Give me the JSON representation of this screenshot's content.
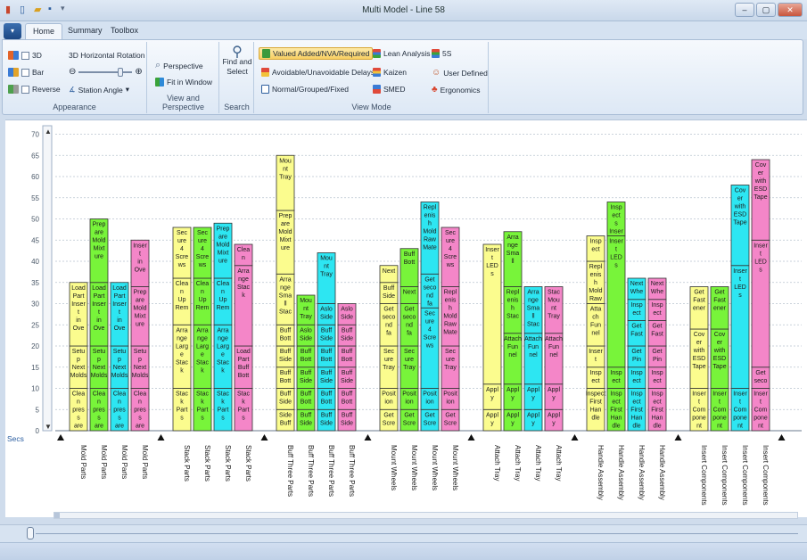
{
  "window": {
    "title": "Multi Model - Line 58",
    "controls": [
      "–",
      "▢",
      "✕"
    ]
  },
  "tabs": [
    {
      "label": "Home",
      "active": true
    },
    {
      "label": "Summary",
      "active": false
    },
    {
      "label": "Toolbox",
      "active": false
    }
  ],
  "ribbon": {
    "appearance": {
      "label": "Appearance",
      "check_3d": "3D",
      "check_bar": "Bar",
      "check_reverse": "Reverse",
      "rotation_label": "3D Horizontal Rotation",
      "station_angle": "Station Angle"
    },
    "view": {
      "label": "View and Perspective",
      "perspective": "Perspective",
      "fit_window": "Fit in Window"
    },
    "search": {
      "label": "Search",
      "find_select_1": "Find and",
      "find_select_2": "Select"
    },
    "view_mode": {
      "label": "View Mode",
      "valued_added": "Valued Added/NVA/Required",
      "avoidable": "Avoidable/Unavoidable Delays",
      "normal": "Normal/Grouped/Fixed",
      "lean": "Lean Analysis",
      "kaizen": "Kaizen",
      "smed": "SMED",
      "five_s": "5S",
      "user_defined": "User Defined",
      "ergonomics": "Ergonomics"
    }
  },
  "colors": {
    "yellow": "#fbfc8e",
    "green": "#78f43a",
    "cyan": "#2de6f2",
    "pink": "#f486c8"
  },
  "chart_data": {
    "type": "bar",
    "ylabel": "Secs",
    "ylim": [
      0,
      72
    ],
    "yticks": [
      0,
      5,
      10,
      15,
      20,
      25,
      30,
      35,
      40,
      45,
      50,
      55,
      60,
      65,
      70
    ],
    "grid": true,
    "stacked": true,
    "groups": [
      {
        "name": "Mold Parts",
        "bars": [
          {
            "color": "yellow",
            "segments": [
              {
                "value": 10,
                "label": "Clea n pres s are a"
              },
              {
                "value": 10,
                "label": "Setu p Next Molds"
              },
              {
                "value": 15,
                "label": "Load Part Inser t in Ove"
              }
            ]
          },
          {
            "color": "green",
            "segments": [
              {
                "value": 10,
                "label": "Clea n pres s are a"
              },
              {
                "value": 10,
                "label": "Setu p Next Molds"
              },
              {
                "value": 15,
                "label": "Load Part Inser t in Ove"
              },
              {
                "value": 15,
                "label": "Prep are Mold Mixt ure"
              }
            ]
          },
          {
            "color": "cyan",
            "segments": [
              {
                "value": 10,
                "label": "Clea n pres s are a"
              },
              {
                "value": 10,
                "label": "Setu p Next Molds"
              },
              {
                "value": 15,
                "label": "Load Part Inser t in Ove"
              }
            ]
          },
          {
            "color": "pink",
            "segments": [
              {
                "value": 10,
                "label": "Clea n pres s are a"
              },
              {
                "value": 10,
                "label": "Setu p Next Molds"
              },
              {
                "value": 14,
                "label": "Prep are Mold Mixt ure"
              },
              {
                "value": 11,
                "label": "Inser t in Ove"
              }
            ]
          }
        ]
      },
      {
        "name": "Stack Parts",
        "bars": [
          {
            "color": "yellow",
            "segments": [
              {
                "value": 10,
                "label": "Stac k Part s"
              },
              {
                "value": 15,
                "label": "Arra nge Larg e Stac k"
              },
              {
                "value": 11,
                "label": "Clea n Up Rem"
              },
              {
                "value": 12,
                "label": "Sec ure 4 Scre ws"
              }
            ]
          },
          {
            "color": "green",
            "segments": [
              {
                "value": 10,
                "label": "Stac k Part s"
              },
              {
                "value": 15,
                "label": "Arra nge Larg e Stac k"
              },
              {
                "value": 11,
                "label": "Clea n Up Rem"
              },
              {
                "value": 12,
                "label": "Sec ure 4 Scre ws"
              }
            ]
          },
          {
            "color": "cyan",
            "segments": [
              {
                "value": 10,
                "label": "Stac k Part s"
              },
              {
                "value": 15,
                "label": "Arra nge Larg e Stac k"
              },
              {
                "value": 11,
                "label": "Clea n Up Rem"
              },
              {
                "value": 13,
                "label": "Prep are Mold Mixt ure"
              }
            ]
          },
          {
            "color": "pink",
            "segments": [
              {
                "value": 10,
                "label": "Stac k Part s"
              },
              {
                "value": 10,
                "label": "Load Part Buff Bott"
              },
              {
                "value": 19,
                "label": "Arra nge Stac k"
              },
              {
                "value": 5,
                "label": "Clea n Up Rem"
              }
            ]
          }
        ]
      },
      {
        "name": "Buff Three Parts",
        "bars": [
          {
            "color": "yellow",
            "segments": [
              {
                "value": 5,
                "label": "Side Buff"
              },
              {
                "value": 5,
                "label": "Buff Side"
              },
              {
                "value": 5,
                "label": "Buff Bott"
              },
              {
                "value": 5,
                "label": "Buff Side"
              },
              {
                "value": 5,
                "label": "Buff Bott"
              },
              {
                "value": 12,
                "label": "Arra nge Sma ll Stac"
              },
              {
                "value": 15,
                "label": "Prep are Mold Mixt ure"
              },
              {
                "value": 13,
                "label": "Mou nt Tray"
              }
            ]
          },
          {
            "color": "green",
            "segments": [
              {
                "value": 5,
                "label": "Buff Side"
              },
              {
                "value": 5,
                "label": "Buff Bott"
              },
              {
                "value": 5,
                "label": "Buff Side"
              },
              {
                "value": 5,
                "label": "Buff Bott"
              },
              {
                "value": 5,
                "label": "Aslo Side"
              },
              {
                "value": 7,
                "label": "Mou nt Tray"
              }
            ]
          },
          {
            "color": "cyan",
            "segments": [
              {
                "value": 5,
                "label": "Buff Side"
              },
              {
                "value": 5,
                "label": "Buff Bott"
              },
              {
                "value": 5,
                "label": "Buff Side"
              },
              {
                "value": 5,
                "label": "Buff Bott"
              },
              {
                "value": 5,
                "label": "Buff Side"
              },
              {
                "value": 5,
                "label": "Aslo Side"
              },
              {
                "value": 12,
                "label": "Mou nt Tray"
              }
            ]
          },
          {
            "color": "pink",
            "segments": [
              {
                "value": 5,
                "label": "Buff Side"
              },
              {
                "value": 5,
                "label": "Buff Bott"
              },
              {
                "value": 5,
                "label": "Buff Side"
              },
              {
                "value": 5,
                "label": "Buff Bott"
              },
              {
                "value": 5,
                "label": "Buff Side"
              },
              {
                "value": 5,
                "label": "Aslo Side"
              }
            ]
          }
        ]
      },
      {
        "name": "Mount Wheels",
        "bars": [
          {
            "color": "yellow",
            "segments": [
              {
                "value": 5,
                "label": "Get Scre"
              },
              {
                "value": 5,
                "label": "Posit ion"
              },
              {
                "value": 10,
                "label": "Sec ure Tray"
              },
              {
                "value": 10,
                "label": "Get seco nd fa"
              },
              {
                "value": 5,
                "label": "Buff Side"
              },
              {
                "value": 4,
                "label": "Next Whe"
              }
            ]
          },
          {
            "color": "green",
            "segments": [
              {
                "value": 5,
                "label": "Get Scre"
              },
              {
                "value": 5,
                "label": "Posit ion"
              },
              {
                "value": 10,
                "label": "Sec ure Tray"
              },
              {
                "value": 10,
                "label": "Get seco nd fa"
              },
              {
                "value": 4,
                "label": "Next Whe"
              },
              {
                "value": 9,
                "label": "Buff Bott"
              }
            ]
          },
          {
            "color": "cyan",
            "segments": [
              {
                "value": 5,
                "label": "Get Scre"
              },
              {
                "value": 5,
                "label": "Posit ion"
              },
              {
                "value": 19,
                "label": "Sec ure 4 Scre ws"
              },
              {
                "value": 8,
                "label": "Get seco nd fa"
              },
              {
                "value": 17,
                "label": "Repl enis h Mold Raw Mate"
              }
            ]
          },
          {
            "color": "pink",
            "segments": [
              {
                "value": 5,
                "label": "Get Scre"
              },
              {
                "value": 5,
                "label": "Posit ion"
              },
              {
                "value": 10,
                "label": "Sec ure Tray"
              },
              {
                "value": 14,
                "label": "Repl enis h Mold Raw Mate"
              },
              {
                "value": 14,
                "label": "Sec ure 4 Scre ws"
              }
            ]
          }
        ]
      },
      {
        "name": "Attach Tray",
        "bars": [
          {
            "color": "yellow",
            "segments": [
              {
                "value": 5,
                "label": "Appl y Fir"
              },
              {
                "value": 6,
                "label": "Appl y Fir"
              },
              {
                "value": 33,
                "label": "Inser t LED s"
              }
            ]
          },
          {
            "color": "green",
            "segments": [
              {
                "value": 5,
                "label": "Appl y Fir"
              },
              {
                "value": 6,
                "label": "Appl y Fir"
              },
              {
                "value": 12,
                "label": "Attach Fun nel"
              },
              {
                "value": 11,
                "label": "Repl enis h Stac"
              },
              {
                "value": 13,
                "label": "Arra nge Sma ll"
              }
            ]
          },
          {
            "color": "cyan",
            "segments": [
              {
                "value": 5,
                "label": "Appl y Fir"
              },
              {
                "value": 6,
                "label": "Appl y Fir"
              },
              {
                "value": 12,
                "label": "Attach Fun nel"
              },
              {
                "value": 11,
                "label": "Arra nge Sma ll Stac"
              }
            ]
          },
          {
            "color": "pink",
            "segments": [
              {
                "value": 5,
                "label": "Appl y Fir"
              },
              {
                "value": 6,
                "label": "Appl y Fir"
              },
              {
                "value": 12,
                "label": "Attach Fun nel"
              },
              {
                "value": 11,
                "label": "Stac Mou nt Tray"
              }
            ]
          }
        ]
      },
      {
        "name": "Handle Assembly",
        "bars": [
          {
            "color": "yellow",
            "segments": [
              {
                "value": 10,
                "label": "Inspect First Han dle"
              },
              {
                "value": 5,
                "label": "Insp ect s"
              },
              {
                "value": 5,
                "label": "Inser t Sp"
              },
              {
                "value": 10,
                "label": "Atta ch Fun nel"
              },
              {
                "value": 10,
                "label": "Repl enis h Mold Raw Mate"
              },
              {
                "value": 6,
                "label": "Insp ect s"
              }
            ]
          },
          {
            "color": "green",
            "segments": [
              {
                "value": 10,
                "label": "Insp ect First Han dle"
              },
              {
                "value": 5,
                "label": "Insp ect s"
              },
              {
                "value": 31,
                "label": "Inser t LED s"
              },
              {
                "value": 8,
                "label": "Insp ect s Inser t Sp"
              }
            ]
          },
          {
            "color": "cyan",
            "segments": [
              {
                "value": 10,
                "label": "Insp ect First Han dle"
              },
              {
                "value": 5,
                "label": "Insp ect s"
              },
              {
                "value": 5,
                "label": "Get Pin"
              },
              {
                "value": 6,
                "label": "Get Fast ener"
              },
              {
                "value": 5,
                "label": "Insp ect s"
              },
              {
                "value": 5,
                "label": "Next Whe"
              }
            ]
          },
          {
            "color": "pink",
            "segments": [
              {
                "value": 10,
                "label": "Insp ect First Han dle"
              },
              {
                "value": 5,
                "label": "Insp ect s"
              },
              {
                "value": 5,
                "label": "Get Pin"
              },
              {
                "value": 6,
                "label": "Get Fast ener"
              },
              {
                "value": 5,
                "label": "Insp ect s"
              },
              {
                "value": 5,
                "label": "Next Whe"
              }
            ]
          }
        ]
      },
      {
        "name": "Insert Components",
        "bars": [
          {
            "color": "yellow",
            "segments": [
              {
                "value": 10,
                "label": "Inser t Com pone nt"
              },
              {
                "value": 14,
                "label": "Cov er with ESD Tape"
              },
              {
                "value": 10,
                "label": "Get Fast ener"
              }
            ]
          },
          {
            "color": "green",
            "segments": [
              {
                "value": 10,
                "label": "Inser t Com pone nt"
              },
              {
                "value": 14,
                "label": "Cov er with ESD Tape"
              },
              {
                "value": 10,
                "label": "Get Fast ener"
              }
            ]
          },
          {
            "color": "cyan",
            "segments": [
              {
                "value": 10,
                "label": "Inser t Com pone nt"
              },
              {
                "value": 29,
                "label": "Inser t LED s"
              },
              {
                "value": 19,
                "label": "Cov er with ESD Tape"
              }
            ]
          },
          {
            "color": "pink",
            "segments": [
              {
                "value": 10,
                "label": "Inser t Com pone nt"
              },
              {
                "value": 5,
                "label": "Get seco nd fa"
              },
              {
                "value": 30,
                "label": "Inser t LED s"
              },
              {
                "value": 19,
                "label": "Cov er with ESD Tape"
              }
            ]
          }
        ]
      }
    ]
  }
}
